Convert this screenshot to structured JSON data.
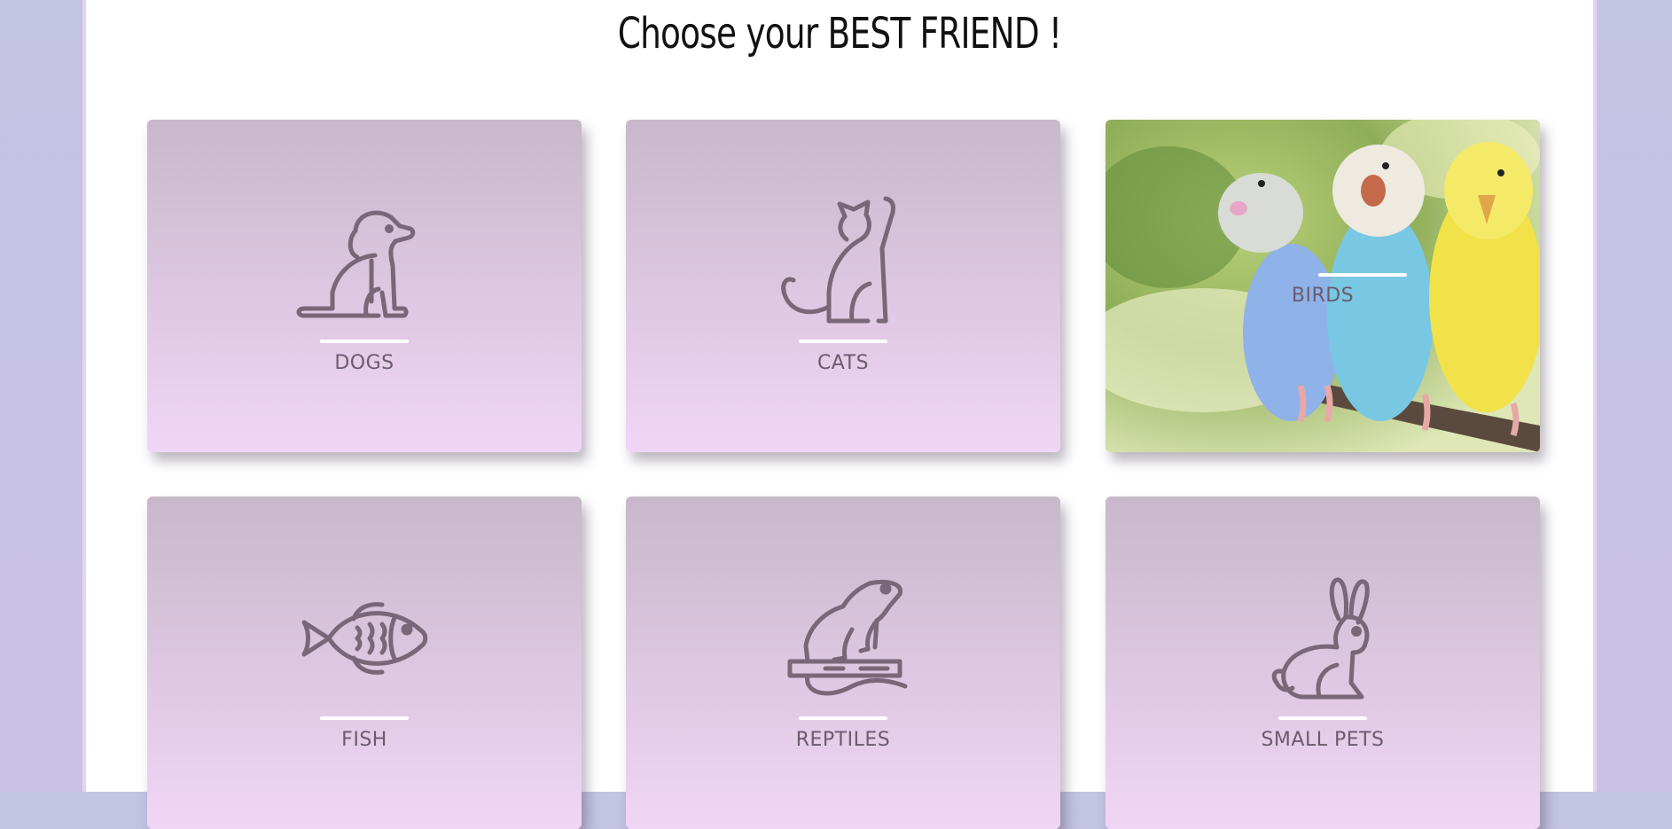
{
  "heading": "Choose your BEST FRIEND !",
  "categories": [
    {
      "label": "DOGS",
      "icon": "dog-icon"
    },
    {
      "label": "CATS",
      "icon": "cat-icon"
    },
    {
      "label": "BIRDS",
      "icon": "birds-photo"
    },
    {
      "label": "FISH",
      "icon": "fish-icon"
    },
    {
      "label": "REPTILES",
      "icon": "frog-icon"
    },
    {
      "label": "SMALL PETS",
      "icon": "rabbit-icon"
    }
  ],
  "colors": {
    "card_top": "#c8b8ca",
    "card_bottom": "#f1d5f7",
    "icon_stroke": "#7a6679",
    "label": "#6b5b6e",
    "background": "#c3c3e2"
  }
}
